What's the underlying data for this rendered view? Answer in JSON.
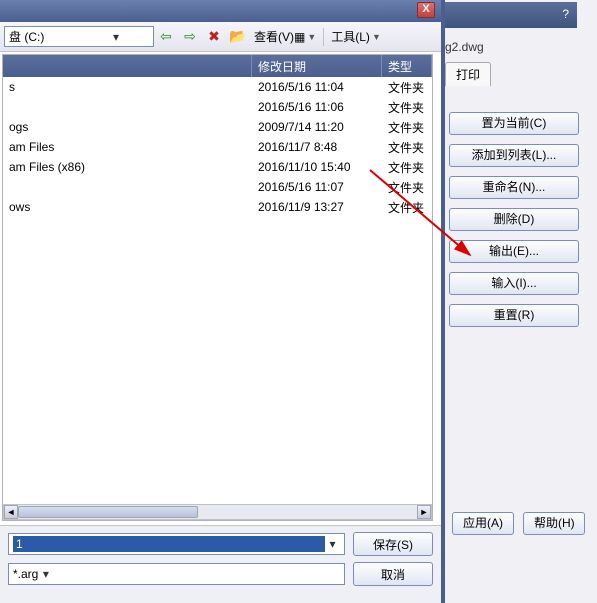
{
  "bg": {
    "help": "?",
    "filename": "g2.dwg",
    "tab_print": "打印",
    "buttons": {
      "set_current": "置为当前(C)",
      "add_to_list": "添加到列表(L)...",
      "rename": "重命名(N)...",
      "delete": "删除(D)",
      "export": "输出(E)...",
      "import": "输入(I)...",
      "reset": "重置(R)"
    },
    "apply": "应用(A)",
    "help_btn": "帮助(H)"
  },
  "dialog": {
    "close": "X",
    "path_label": "盘 (C:)",
    "view_menu": "查看(V)",
    "tools_menu": "工具(L)",
    "columns": {
      "name": "",
      "date": "修改日期",
      "type": "类型"
    },
    "rows": [
      {
        "name": "s",
        "date": "2016/5/16 11:04",
        "type": "文件夹"
      },
      {
        "name": "",
        "date": "2016/5/16 11:06",
        "type": "文件夹"
      },
      {
        "name": "ogs",
        "date": "2009/7/14 11:20",
        "type": "文件夹"
      },
      {
        "name": "am Files",
        "date": "2016/11/7 8:48",
        "type": "文件夹"
      },
      {
        "name": "am Files (x86)",
        "date": "2016/11/10 15:40",
        "type": "文件夹"
      },
      {
        "name": "",
        "date": "2016/5/16 11:07",
        "type": "文件夹"
      },
      {
        "name": "ows",
        "date": "2016/11/9 13:27",
        "type": "文件夹"
      }
    ],
    "filename_value": "1",
    "filetype_value": "*.arg",
    "save_btn": "保存(S)",
    "cancel_btn": "取消"
  },
  "icons": {
    "back": "⇦",
    "forward": "⇨",
    "delete": "✖",
    "folder": "📂",
    "views": "▦"
  }
}
